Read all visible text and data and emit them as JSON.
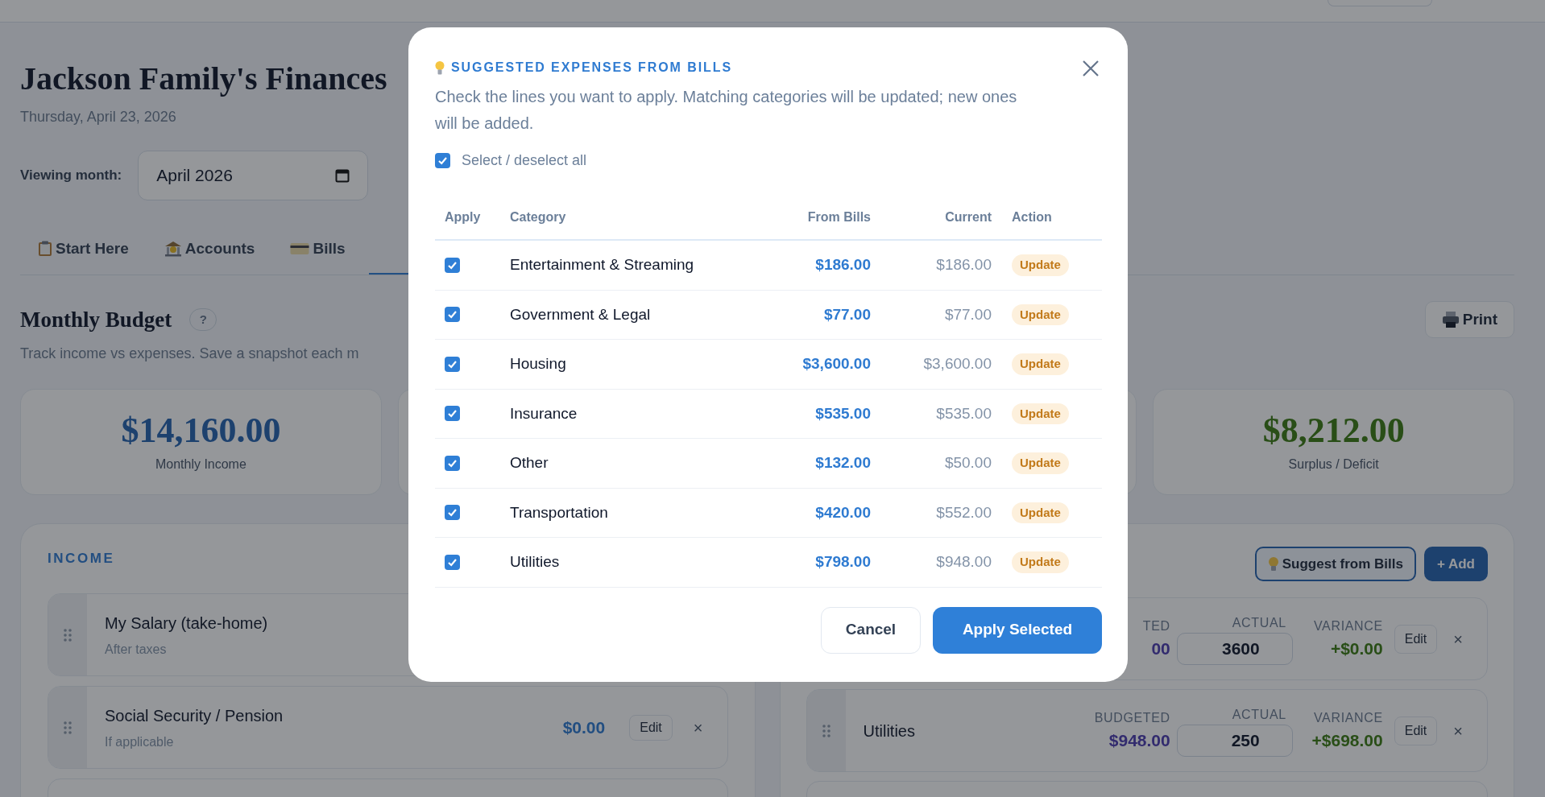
{
  "header": {
    "title": "Jackson Family's Finances",
    "date": "Thursday, April 23, 2026",
    "month_label": "Viewing month:",
    "month_value": "April 2026"
  },
  "tabs": [
    {
      "label": "Start Here",
      "selected": false
    },
    {
      "label": "Accounts",
      "selected": false
    },
    {
      "label": "Bills",
      "selected": false
    },
    {
      "selected": true
    }
  ],
  "budget": {
    "title": "Monthly Budget",
    "help": "?",
    "subtitle": "Track income vs expenses. Save a snapshot each m",
    "print_button": "Print"
  },
  "stats": [
    {
      "value": "$14,160.00",
      "label": "Monthly Income"
    },
    {
      "value": "$8,212.00",
      "label": "Surplus / Deficit"
    }
  ],
  "income": {
    "title": "INCOME",
    "rows": [
      {
        "name": "My Salary (take-home)",
        "note": "After taxes"
      },
      {
        "name": "Social Security / Pension",
        "note": "If applicable",
        "amount": "$0.00",
        "edit": "Edit",
        "remove": "×"
      }
    ]
  },
  "expenses": {
    "suggest_button": "Suggest from Bills",
    "add_button": "+ Add",
    "rows": [
      {
        "budgeted_label": "TED",
        "budgeted": "00",
        "actual_label": "ACTUAL",
        "actual": "3600",
        "variance_label": "VARIANCE",
        "variance": "+$0.00",
        "edit": "Edit",
        "remove": "×"
      },
      {
        "name": "Utilities",
        "budgeted_label": "BUDGETED",
        "budgeted": "$948.00",
        "actual_label": "ACTUAL",
        "actual": "250",
        "variance_label": "VARIANCE",
        "variance": "+$698.00",
        "edit": "Edit",
        "remove": "×"
      }
    ]
  },
  "modal": {
    "title": "SUGGESTED EXPENSES FROM BILLS",
    "description": "Check the lines you want to apply. Matching categories will be updated; new ones will be added.",
    "select_all": {
      "label": "Select / deselect all",
      "checked": true
    },
    "columns": [
      "Apply",
      "Category",
      "From Bills",
      "Current",
      "Action"
    ],
    "rows": [
      {
        "checked": true,
        "category": "Entertainment & Streaming",
        "from_bills": "$186.00",
        "current": "$186.00",
        "action": "Update"
      },
      {
        "checked": true,
        "category": "Government & Legal",
        "from_bills": "$77.00",
        "current": "$77.00",
        "action": "Update"
      },
      {
        "checked": true,
        "category": "Housing",
        "from_bills": "$3,600.00",
        "current": "$3,600.00",
        "action": "Update"
      },
      {
        "checked": true,
        "category": "Insurance",
        "from_bills": "$535.00",
        "current": "$535.00",
        "action": "Update"
      },
      {
        "checked": true,
        "category": "Other",
        "from_bills": "$132.00",
        "current": "$50.00",
        "action": "Update"
      },
      {
        "checked": true,
        "category": "Transportation",
        "from_bills": "$420.00",
        "current": "$552.00",
        "action": "Update"
      },
      {
        "checked": true,
        "category": "Utilities",
        "from_bills": "$798.00",
        "current": "$948.00",
        "action": "Update"
      }
    ],
    "cancel_button": "Cancel",
    "apply_button": "Apply Selected"
  }
}
